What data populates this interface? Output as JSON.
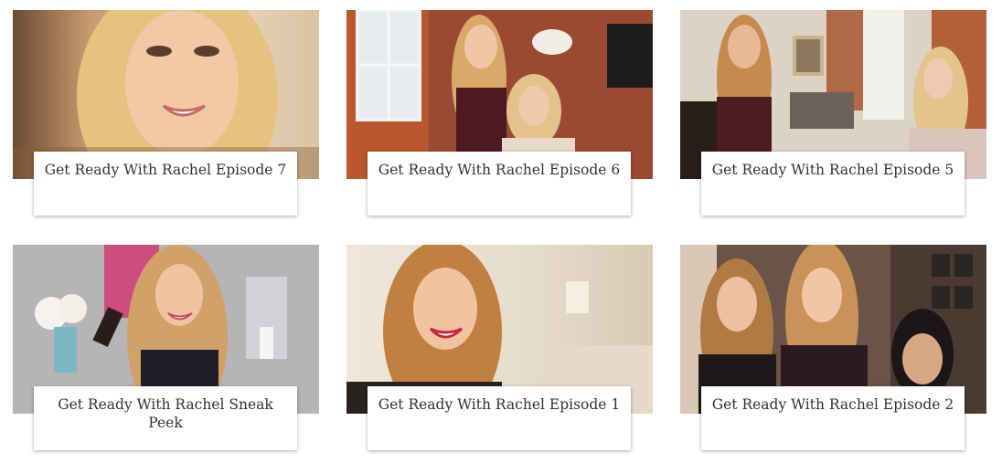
{
  "cards": [
    {
      "title": "Get Ready With Rachel Episode 7"
    },
    {
      "title": "Get Ready With Rachel Episode 6"
    },
    {
      "title": "Get Ready With Rachel Episode 5"
    },
    {
      "title": "Get Ready With Rachel Sneak Peek"
    },
    {
      "title": "Get Ready With Rachel Episode 1"
    },
    {
      "title": "Get Ready With Rachel Episode 2"
    }
  ]
}
